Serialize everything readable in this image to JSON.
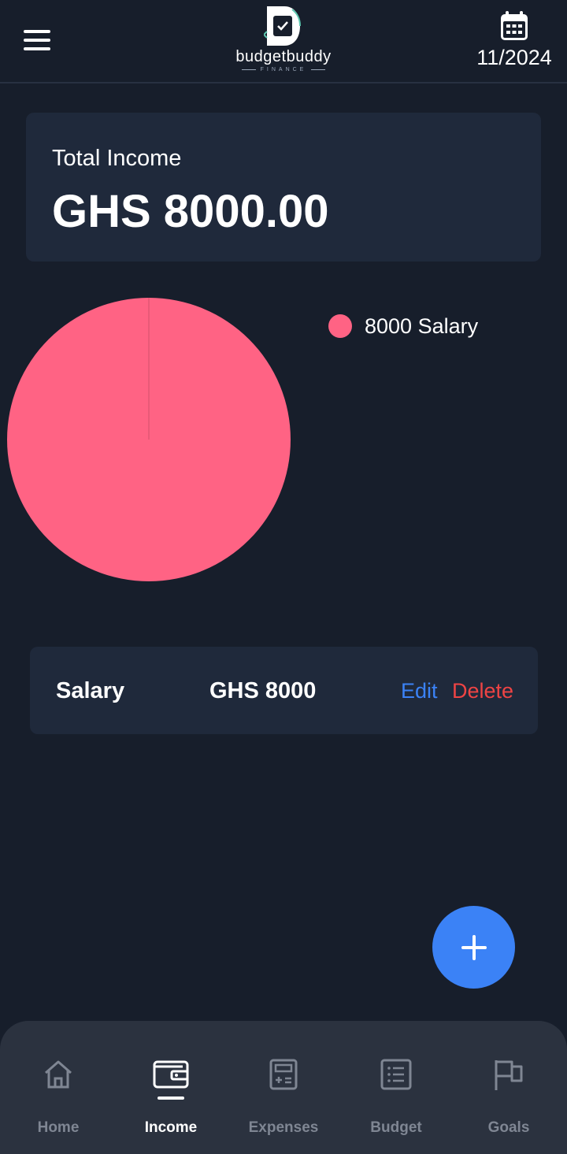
{
  "header": {
    "brand_name": "budgetbuddy",
    "brand_sub": "FINANCE",
    "date": "11/2024"
  },
  "summary": {
    "label": "Total Income",
    "value": "GHS 8000.00"
  },
  "chart_data": {
    "type": "pie",
    "categories": [
      "Salary"
    ],
    "values": [
      8000
    ],
    "colors": [
      "#ff6384"
    ],
    "legend": [
      "8000 Salary"
    ],
    "legend_position": "right"
  },
  "income_items": [
    {
      "name": "Salary",
      "amount": "GHS 8000",
      "edit": "Edit",
      "delete": "Delete"
    }
  ],
  "nav": {
    "items": [
      {
        "label": "Home",
        "icon": "home-icon",
        "active": false
      },
      {
        "label": "Income",
        "icon": "wallet-icon",
        "active": true
      },
      {
        "label": "Expenses",
        "icon": "calculator-icon",
        "active": false
      },
      {
        "label": "Budget",
        "icon": "list-icon",
        "active": false
      },
      {
        "label": "Goals",
        "icon": "flag-icon",
        "active": false
      }
    ]
  },
  "colors": {
    "background": "#171e2b",
    "card": "#1f293b",
    "accent": "#3b82f6",
    "danger": "#ef4444",
    "pie": "#ff6384"
  }
}
